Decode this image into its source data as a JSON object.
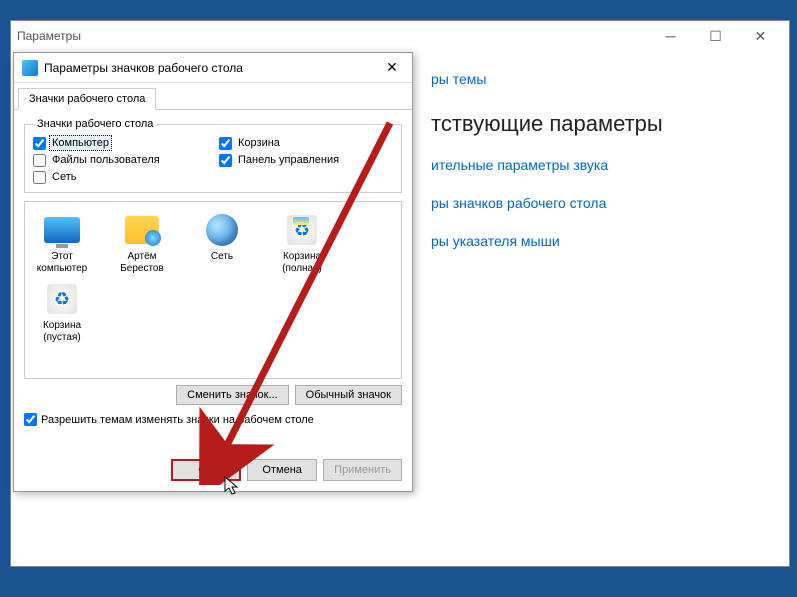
{
  "settingsWindow": {
    "title": "Параметры",
    "partialLink": "ры темы",
    "partialHeading": "тствующие параметры",
    "links": [
      "ительные параметры звука",
      "ры значков рабочего стола",
      "ры указателя мыши"
    ]
  },
  "dialog": {
    "title": "Параметры значков рабочего стола",
    "tab": "Значки рабочего стола",
    "groupLabel": "Значки рабочего стола",
    "checkboxes": [
      {
        "label": "Компьютер",
        "checked": true,
        "highlighted": true
      },
      {
        "label": "Корзина",
        "checked": true,
        "highlighted": false
      },
      {
        "label": "Файлы пользователя",
        "checked": false,
        "highlighted": false
      },
      {
        "label": "Панель управления",
        "checked": true,
        "highlighted": false
      },
      {
        "label": "Сеть",
        "checked": false,
        "highlighted": false
      }
    ],
    "icons": [
      {
        "label": "Этот компьютер",
        "kind": "monitor"
      },
      {
        "label": "Артём Берестов",
        "kind": "folder-user"
      },
      {
        "label": "Сеть",
        "kind": "globe"
      },
      {
        "label": "Корзина (полная)",
        "kind": "recycle-full"
      },
      {
        "label": "Корзина (пустая)",
        "kind": "recycle"
      }
    ],
    "buttons": {
      "changeIcon": "Сменить значок...",
      "defaultIcon": "Обычный значок"
    },
    "allowThemes": {
      "label": "Разрешить темам изменять значки на рабочем столе",
      "checked": true
    },
    "footer": {
      "ok": "OK",
      "cancel": "Отмена",
      "apply": "Применить"
    }
  }
}
